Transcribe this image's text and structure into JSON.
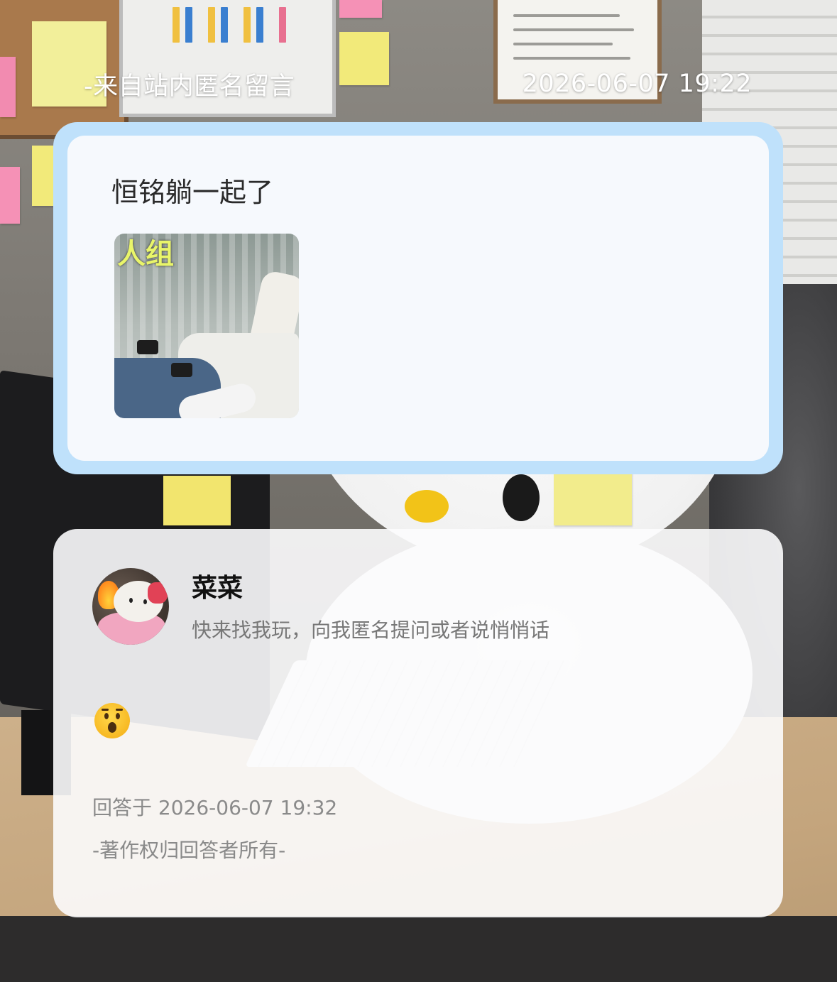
{
  "header": {
    "source": "-来自站内匿名留言",
    "timestamp": "2026-06-07 19:22"
  },
  "question": {
    "text": "恒铭躺一起了",
    "image_caption": "人组"
  },
  "answer": {
    "user_name": "菜菜",
    "user_bio": "快来找我玩，向我匿名提问或者说悄悄话",
    "emoji": "hushed-face-emoji",
    "answered_at": "回答于 2026-06-07 19:32",
    "copyright": "-著作权归回答者所有-"
  },
  "colors": {
    "card_border": "#bfe1fb",
    "card_background": "#fcfcfd",
    "header_text": "#ffffff",
    "meta_text": "#8a8a8a"
  }
}
